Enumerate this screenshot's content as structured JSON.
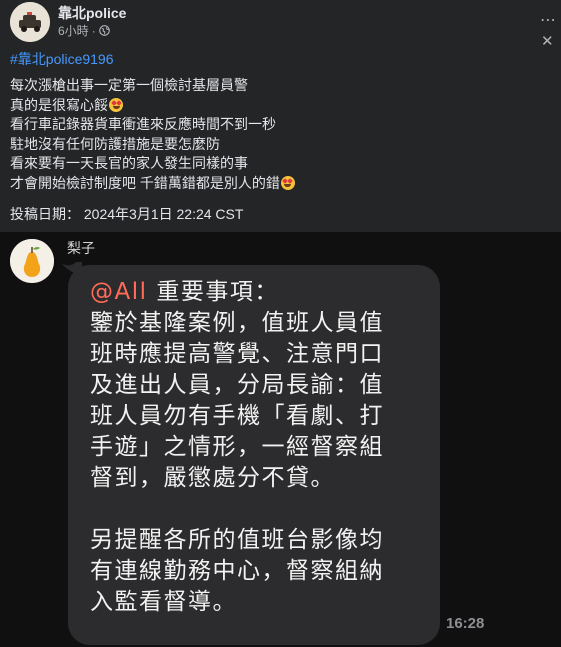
{
  "post": {
    "author": "靠北police",
    "time": "6小時",
    "separator": "·",
    "more_icon": "⋯",
    "close_icon": "✕",
    "hashtag": "#靠北police9196",
    "lines": [
      "每次漲槍出事一定第一個檢討基層員警",
      "真的是很寫心餒",
      "看行車記錄器貨車衝進來反應時間不到一秒",
      "駐地沒有任何防護措施是要怎麼防",
      "看來要有一天長官的家人發生同樣的事",
      "才會開始檢討制度吧 千錯萬錯都是別人的錯"
    ],
    "emoji_after_lines": [
      1,
      5
    ],
    "post_date": "投稿日期： 2024年3月1日 22:24 CST"
  },
  "chat": {
    "sender": "梨子",
    "mention": "@All",
    "message_lines": [
      " 重要事項：",
      "鑒於基隆案例，值班人員值",
      "班時應提高警覺、注意門口",
      "及進出人員，分局長諭：值",
      "班人員勿有手機「看劇、打",
      "手遊」之情形，一經督察組",
      "督到，嚴懲處分不貸。"
    ],
    "message_lines_2": [
      "另提醒各所的值班台影像均",
      "有連線勤務中心，督察組納",
      "入監看督導。"
    ],
    "timestamp": "16:28"
  },
  "colors": {
    "accent_link": "#4599ff",
    "mention": "#ff6b57",
    "post_bg": "#242526",
    "chat_bg": "#101010",
    "bubble": "#2c2c2e"
  }
}
